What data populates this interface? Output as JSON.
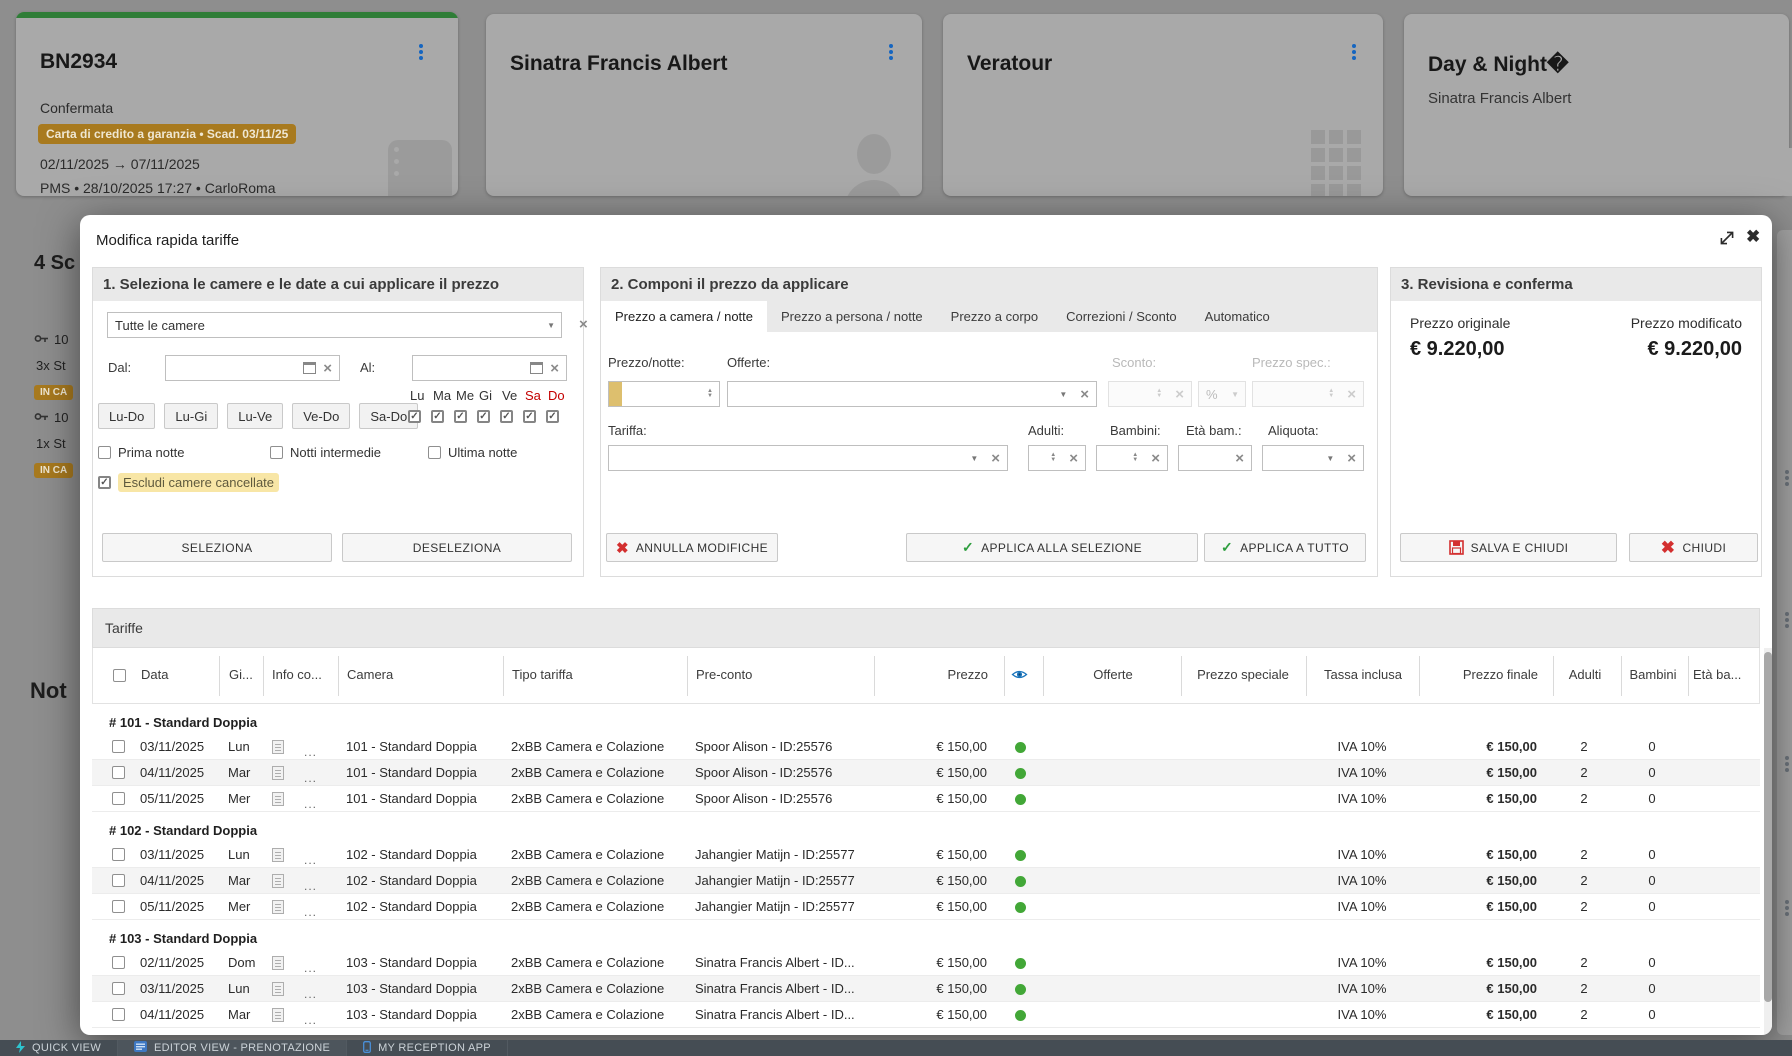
{
  "background": {
    "cards": [
      {
        "title": "BN2934",
        "status": "Confermata",
        "badge": "Carta di credito a garanzia • Scad. 03/11/25",
        "dates": "02/11/2025 → 07/11/2025",
        "meta": "PMS • 28/10/2025 17:27 • CarloRoma",
        "accent": "#2f7d37",
        "icon": "ticket-icon"
      },
      {
        "title": "Sinatra Francis Albert",
        "icon": "person-icon"
      },
      {
        "title": "Veratour",
        "icon": "building-icon"
      },
      {
        "title": "Day & Night�",
        "subtitle": "Sinatra Francis Albert"
      }
    ],
    "left_fragments": {
      "heading": "4 Sc",
      "row1_key": "10",
      "row1_qty": "3x St",
      "row1_badge": "IN CA",
      "row2_key": "10",
      "row2_qty": "1x St",
      "row2_badge": "IN CA",
      "notes_heading": "Not"
    }
  },
  "modal": {
    "title": "Modifica rapida tariffe",
    "section1": {
      "header": "1. Seleziona le camere e le date a cui applicare il prezzo",
      "room_select_value": "Tutte le camere",
      "dal_label": "Dal:",
      "al_label": "Al:",
      "quick_buttons": [
        "Lu-Do",
        "Lu-Gi",
        "Lu-Ve",
        "Ve-Do",
        "Sa-Do"
      ],
      "weekdays": [
        "Lu",
        "Ma",
        "Me",
        "Gi",
        "Ve",
        "Sa",
        "Do"
      ],
      "weekend_days": [
        "Sa",
        "Do"
      ],
      "options": [
        "Prima notte",
        "Notti intermedie",
        "Ultima notte"
      ],
      "exclude_label": "Escludi camere cancellate",
      "exclude_checked": true,
      "select_button": "SELEZIONA",
      "deselect_button": "DESELEZIONA"
    },
    "section2": {
      "header": "2. Componi il prezzo da applicare",
      "tabs": [
        "Prezzo a camera / notte",
        "Prezzo a persona / notte",
        "Prezzo a corpo",
        "Correzioni / Sconto",
        "Automatico"
      ],
      "active_tab": "Prezzo a camera / notte",
      "prezzo_notte_label": "Prezzo/notte:",
      "offerte_label": "Offerte:",
      "sconto_label": "Sconto:",
      "percent_label": "%",
      "prezzo_spec_label": "Prezzo spec.:",
      "tariffa_label": "Tariffa:",
      "adulti_label": "Adulti:",
      "bambini_label": "Bambini:",
      "eta_bam_label": "Età bam.:",
      "aliquota_label": "Aliquota:",
      "annulla_button": "ANNULLA MODIFICHE",
      "applica_selezione_button": "APPLICA ALLA SELEZIONE",
      "applica_tutto_button": "APPLICA A TUTTO"
    },
    "section3": {
      "header": "3. Revisiona e conferma",
      "original_label": "Prezzo originale",
      "original_value": "€ 9.220,00",
      "modified_label": "Prezzo modificato",
      "modified_value": "€ 9.220,00",
      "salva_button": "SALVA E CHIUDI",
      "chiudi_button": "CHIUDI"
    },
    "table": {
      "title": "Tariffe",
      "columns": [
        "Data",
        "Gi...",
        "Info co...",
        "Camera",
        "Tipo tariffa",
        "Pre-conto",
        "Prezzo",
        "Offerte",
        "Prezzo speciale",
        "Tassa inclusa",
        "Prezzo finale",
        "Adulti",
        "Bambini",
        "Età ba..."
      ],
      "groups": [
        {
          "label": "# 101 - Standard Doppia",
          "rows": [
            {
              "date": "03/11/2025",
              "day": "Lun",
              "camera": "101 - Standard Doppia",
              "tipo": "2xBB Camera e Colazione",
              "preconto": "Spoor Alison - ID:25576",
              "prezzo": "€ 150,00",
              "tassa": "IVA 10%",
              "finale": "€ 150,00",
              "adulti": "2",
              "bambini": "0"
            },
            {
              "date": "04/11/2025",
              "day": "Mar",
              "camera": "101 - Standard Doppia",
              "tipo": "2xBB Camera e Colazione",
              "preconto": "Spoor Alison - ID:25576",
              "prezzo": "€ 150,00",
              "tassa": "IVA 10%",
              "finale": "€ 150,00",
              "adulti": "2",
              "bambini": "0"
            },
            {
              "date": "05/11/2025",
              "day": "Mer",
              "camera": "101 - Standard Doppia",
              "tipo": "2xBB Camera e Colazione",
              "preconto": "Spoor Alison - ID:25576",
              "prezzo": "€ 150,00",
              "tassa": "IVA 10%",
              "finale": "€ 150,00",
              "adulti": "2",
              "bambini": "0"
            }
          ]
        },
        {
          "label": "# 102 - Standard Doppia",
          "rows": [
            {
              "date": "03/11/2025",
              "day": "Lun",
              "camera": "102 - Standard Doppia",
              "tipo": "2xBB Camera e Colazione",
              "preconto": "Jahangier Matijn - ID:25577",
              "prezzo": "€ 150,00",
              "tassa": "IVA 10%",
              "finale": "€ 150,00",
              "adulti": "2",
              "bambini": "0"
            },
            {
              "date": "04/11/2025",
              "day": "Mar",
              "camera": "102 - Standard Doppia",
              "tipo": "2xBB Camera e Colazione",
              "preconto": "Jahangier Matijn - ID:25577",
              "prezzo": "€ 150,00",
              "tassa": "IVA 10%",
              "finale": "€ 150,00",
              "adulti": "2",
              "bambini": "0"
            },
            {
              "date": "05/11/2025",
              "day": "Mer",
              "camera": "102 - Standard Doppia",
              "tipo": "2xBB Camera e Colazione",
              "preconto": "Jahangier Matijn - ID:25577",
              "prezzo": "€ 150,00",
              "tassa": "IVA 10%",
              "finale": "€ 150,00",
              "adulti": "2",
              "bambini": "0"
            }
          ]
        },
        {
          "label": "# 103 - Standard Doppia",
          "rows": [
            {
              "date": "02/11/2025",
              "day": "Dom",
              "camera": "103 - Standard Doppia",
              "tipo": "2xBB Camera e Colazione",
              "preconto": "Sinatra Francis Albert - ID...",
              "prezzo": "€ 150,00",
              "tassa": "IVA 10%",
              "finale": "€ 150,00",
              "adulti": "2",
              "bambini": "0"
            },
            {
              "date": "03/11/2025",
              "day": "Lun",
              "camera": "103 - Standard Doppia",
              "tipo": "2xBB Camera e Colazione",
              "preconto": "Sinatra Francis Albert - ID...",
              "prezzo": "€ 150,00",
              "tassa": "IVA 10%",
              "finale": "€ 150,00",
              "adulti": "2",
              "bambini": "0"
            },
            {
              "date": "04/11/2025",
              "day": "Mar",
              "camera": "103 - Standard Doppia",
              "tipo": "2xBB Camera e Colazione",
              "preconto": "Sinatra Francis Albert - ID...",
              "prezzo": "€ 150,00",
              "tassa": "IVA 10%",
              "finale": "€ 150,00",
              "adulti": "2",
              "bambini": "0"
            }
          ]
        }
      ]
    }
  },
  "taskbar": {
    "items": [
      {
        "label": "QUICK VIEW",
        "icon": "lightning-icon"
      },
      {
        "label": "EDITOR VIEW - PRENOTAZIONE",
        "icon": "editor-icon"
      },
      {
        "label": "MY RECEPTION APP",
        "icon": "phone-icon"
      }
    ]
  },
  "colors": {
    "card_accent_green": "#2f7d37",
    "badge_amber": "#a87a1f",
    "weekend_red": "#c40000",
    "status_dot_green": "#42a737",
    "highlight_yellow": "#f8e6a6",
    "kebab_blue": "#1565c0",
    "eye_blue": "#1b75bc",
    "danger_red": "#d32f2f",
    "success_green": "#2e9e3f",
    "taskbar_bg": "#454d54"
  }
}
